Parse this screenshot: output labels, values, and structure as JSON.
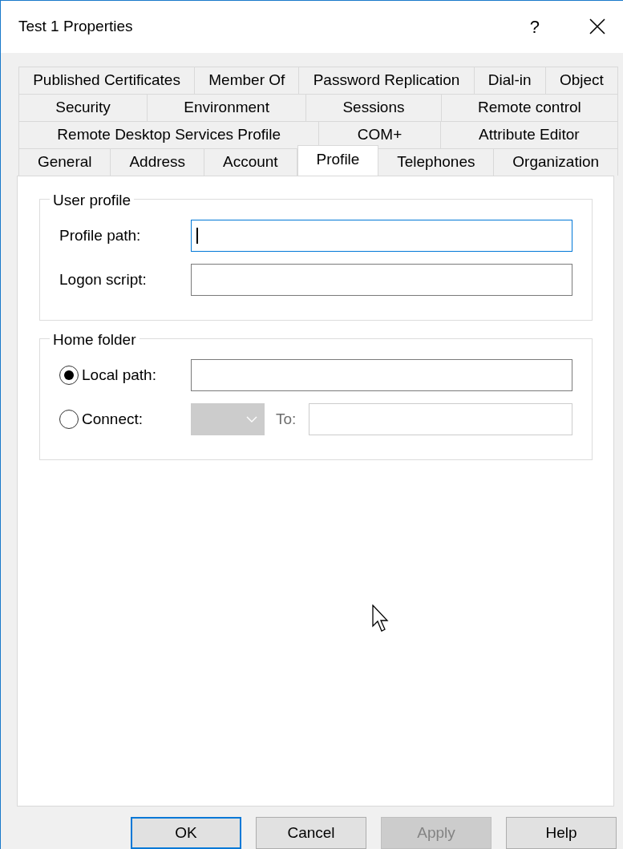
{
  "window": {
    "title": "Test 1 Properties",
    "help_button": "?"
  },
  "tab_rows": [
    [
      {
        "label": "Published Certificates",
        "selected": false
      },
      {
        "label": "Member Of",
        "selected": false
      },
      {
        "label": "Password Replication",
        "selected": false
      },
      {
        "label": "Dial-in",
        "selected": false
      },
      {
        "label": "Object",
        "selected": false
      }
    ],
    [
      {
        "label": "Security",
        "selected": false
      },
      {
        "label": "Environment",
        "selected": false
      },
      {
        "label": "Sessions",
        "selected": false
      },
      {
        "label": "Remote control",
        "selected": false
      }
    ],
    [
      {
        "label": "Remote Desktop Services Profile",
        "selected": false
      },
      {
        "label": "COM+",
        "selected": false
      },
      {
        "label": "Attribute Editor",
        "selected": false
      }
    ],
    [
      {
        "label": "General",
        "selected": false
      },
      {
        "label": "Address",
        "selected": false
      },
      {
        "label": "Account",
        "selected": false
      },
      {
        "label": "Profile",
        "selected": true
      },
      {
        "label": "Telephones",
        "selected": false
      },
      {
        "label": "Organization",
        "selected": false
      }
    ]
  ],
  "user_profile": {
    "title": "User profile",
    "fields": [
      {
        "label": "Profile path:",
        "focused": true
      },
      {
        "label": "Logon script:",
        "focused": false
      }
    ]
  },
  "home_folder": {
    "title": "Home folder",
    "options": [
      {
        "kind": "path",
        "label": "Local path:",
        "selected": true
      },
      {
        "kind": "connect",
        "label": "Connect:",
        "selected": false,
        "disabled": true,
        "to_label": "To:"
      }
    ]
  },
  "buttons": [
    {
      "label": "OK",
      "default": true,
      "disabled": false
    },
    {
      "label": "Cancel",
      "default": false,
      "disabled": false
    },
    {
      "label": "Apply",
      "default": false,
      "disabled": true
    },
    {
      "label": "Help",
      "default": false,
      "disabled": false
    }
  ]
}
